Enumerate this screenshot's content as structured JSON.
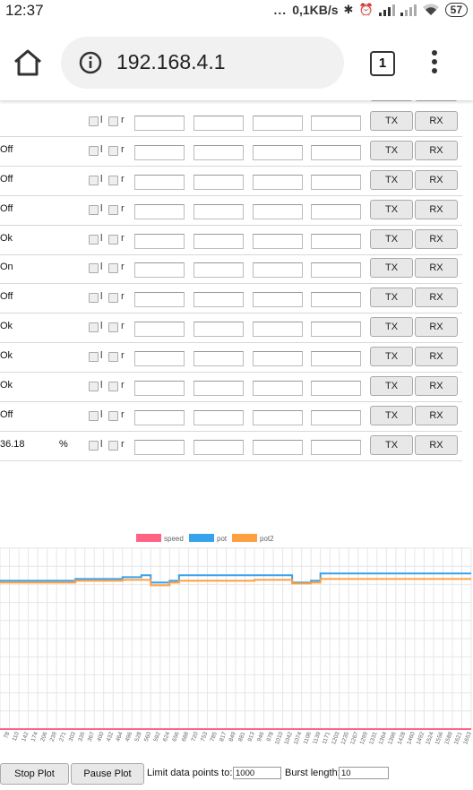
{
  "statusbar": {
    "time": "12:37",
    "dots": "...",
    "speed": "0,1KB/s",
    "battery": "57"
  },
  "browser": {
    "url": "192.168.4.1",
    "tab_count": "1"
  },
  "rows": [
    {
      "value": "",
      "unit": ""
    },
    {
      "value": "Off",
      "unit": ""
    },
    {
      "value": "Off",
      "unit": ""
    },
    {
      "value": "Off",
      "unit": ""
    },
    {
      "value": "Ok",
      "unit": ""
    },
    {
      "value": "On",
      "unit": ""
    },
    {
      "value": "Off",
      "unit": ""
    },
    {
      "value": "Ok",
      "unit": ""
    },
    {
      "value": "Ok",
      "unit": ""
    },
    {
      "value": "Ok",
      "unit": ""
    },
    {
      "value": "Off",
      "unit": ""
    },
    {
      "value": "36.18",
      "unit": "%"
    }
  ],
  "row_labels": {
    "cb1": "l",
    "cb2": "r",
    "tx": "TX",
    "rx": "RX"
  },
  "chart_data": {
    "type": "line",
    "legend": [
      "speed",
      "pot",
      "pot2"
    ],
    "colors": {
      "speed": "#ff6384",
      "pot": "#36a2eb",
      "pot2": "#ff9f40"
    },
    "x_ticks": [
      "47",
      "78",
      "110",
      "142",
      "174",
      "206",
      "239",
      "271",
      "303",
      "335",
      "367",
      "400",
      "432",
      "464",
      "496",
      "528",
      "560",
      "592",
      "624",
      "656",
      "688",
      "720",
      "753",
      "785",
      "817",
      "849",
      "881",
      "913",
      "946",
      "978",
      "1010",
      "1042",
      "1074",
      "1106",
      "1139",
      "1171",
      "1203",
      "1235",
      "1267",
      "1299",
      "1331",
      "1364",
      "1396",
      "1428",
      "1460",
      "1492",
      "1524",
      "1556",
      "1589",
      "1621",
      "1653"
    ],
    "series": [
      {
        "name": "speed",
        "values": [
          0,
          0,
          0,
          0,
          0,
          0,
          0,
          0,
          0,
          0,
          0,
          0,
          0,
          0,
          0,
          0,
          0,
          0,
          0,
          0,
          0,
          0,
          0,
          0,
          0,
          0,
          0,
          0,
          0,
          0,
          0,
          0,
          0,
          0,
          0,
          0,
          0,
          0,
          0,
          0,
          0,
          0,
          0,
          0,
          0,
          0,
          0,
          0,
          0,
          0,
          0
        ]
      },
      {
        "name": "pot",
        "values": [
          820,
          820,
          820,
          820,
          820,
          820,
          820,
          820,
          830,
          830,
          830,
          830,
          830,
          840,
          840,
          850,
          810,
          810,
          820,
          850,
          850,
          850,
          850,
          850,
          850,
          850,
          850,
          850,
          850,
          850,
          850,
          810,
          810,
          820,
          860,
          860,
          860,
          860,
          860,
          860,
          860,
          860,
          860,
          860,
          860,
          860,
          860,
          860,
          860,
          860,
          860
        ]
      },
      {
        "name": "pot2",
        "values": [
          810,
          810,
          810,
          810,
          810,
          810,
          810,
          810,
          820,
          820,
          820,
          820,
          820,
          825,
          825,
          825,
          795,
          795,
          810,
          820,
          820,
          820,
          820,
          820,
          820,
          820,
          820,
          825,
          825,
          825,
          825,
          805,
          805,
          810,
          830,
          830,
          830,
          830,
          830,
          830,
          830,
          830,
          830,
          830,
          830,
          830,
          830,
          830,
          830,
          830,
          830
        ]
      }
    ],
    "ylim": [
      0,
      1000
    ],
    "grid": true,
    "legend_position": "top"
  },
  "controls": {
    "stop_label": "Stop Plot",
    "pause_label": "Pause Plot",
    "limit_label": "Limit data points to:",
    "limit_value": "1000",
    "burst_label": "Burst length:",
    "burst_value": "10"
  }
}
